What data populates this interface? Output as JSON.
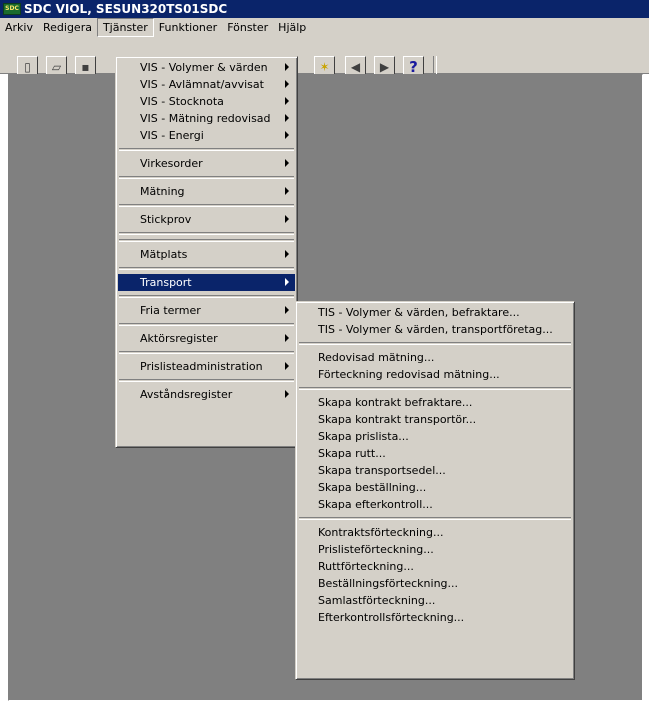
{
  "window": {
    "title": "SDC VIOL, SESUN320TS01SDC",
    "icon_text": "SDC"
  },
  "menubar": [
    "Arkiv",
    "Redigera",
    "Tjänster",
    "Funktioner",
    "Fönster",
    "Hjälp"
  ],
  "toolbar": {
    "help_label": "?"
  },
  "tjanster_menu": {
    "group1": [
      "VIS - Volymer & värden",
      "VIS - Avlämnat/avvisat",
      "VIS - Stocknota",
      "VIS - Mätning redovisad",
      "VIS - Energi"
    ],
    "virkesorder": "Virkesorder",
    "matning": "Mätning",
    "stickprov": "Stickprov",
    "matplats": "Mätplats",
    "transport": "Transport",
    "fria_termer": "Fria termer",
    "aktorsregister": "Aktörsregister",
    "prislisteadmin": "Prislisteadministration",
    "avstandsregister": "Avståndsregister"
  },
  "transport_menu": {
    "group1": [
      "TIS - Volymer & värden, befraktare...",
      "TIS - Volymer & värden, transportföretag..."
    ],
    "group2": [
      "Redovisad mätning...",
      "Förteckning redovisad mätning..."
    ],
    "group3": [
      "Skapa kontrakt befraktare...",
      "Skapa kontrakt transportör...",
      "Skapa prislista...",
      "Skapa rutt...",
      "Skapa transportsedel...",
      "Skapa beställning...",
      "Skapa efterkontroll..."
    ],
    "group4": [
      "Kontraktsförteckning...",
      "Prislisteförteckning...",
      "Ruttförteckning...",
      "Beställningsförteckning...",
      "Samlastförteckning...",
      "Efterkontrollsförteckning..."
    ]
  }
}
